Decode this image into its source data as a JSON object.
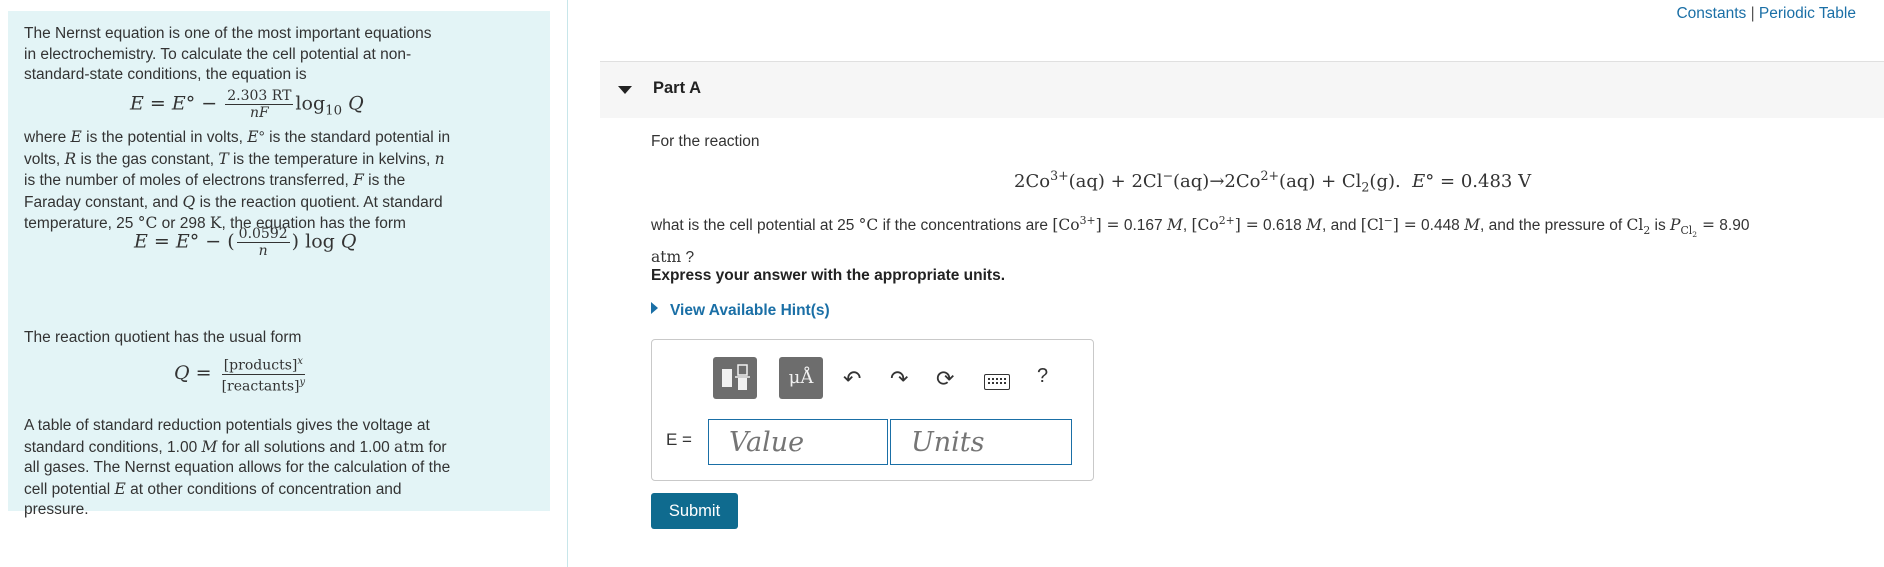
{
  "links": {
    "constants": "Constants",
    "separator": " | ",
    "periodic_table": "Periodic Table"
  },
  "info": {
    "para1": "The Nernst equation is one of the most important equations in electrochemistry. To calculate the cell potential at non-standard-state conditions, the equation is",
    "para2_a": "where ",
    "para2_b": " is the potential in volts, ",
    "para2_c": " is the standard potential in volts, ",
    "para2_d": " is the gas constant, ",
    "para2_e": " is the temperature in kelvins, ",
    "para2_f": " is the number of moles of electrons transferred, ",
    "para2_g": " is the Faraday constant, and ",
    "para2_h": " is the reaction quotient. At standard temperature, 25 ",
    "para2_i": " or 298 ",
    "para2_j": ", the equation has the form",
    "para3": "The reaction quotient has the usual form",
    "para4_a": "A table of standard reduction potentials gives the voltage at standard conditions, 1.00 ",
    "para4_b": " for all solutions and 1.00 ",
    "para4_c": " for all gases. The Nernst equation allows for the calculation of the cell potential ",
    "para4_d": " at other conditions of concentration and pressure.",
    "eq1_frac_num": "2.303 RT",
    "eq1_frac_den": "nF",
    "eq2_frac_num": "0.0592",
    "eq2_frac_den": "n",
    "eq3_num": "[products]",
    "eq3_den": "[reactants]"
  },
  "part": {
    "title": "Part A"
  },
  "question": {
    "intro": "For the reaction",
    "line_a": "what is the cell potential at 25 ",
    "line_b": " if the concentrations are ",
    "co3": "0.167",
    "co2": "0.618",
    "cl": "0.448",
    "pressure": "8.90",
    "and1": ", and ",
    "pressure_text": ", and the pressure of ",
    "is": " is ",
    "units_atm": "atm",
    "q_end": " ?",
    "express": "Express your answer with the appropriate units.",
    "e0_value": "0.483"
  },
  "hint": {
    "label": "View Available Hint(s)"
  },
  "answer": {
    "label": "E =",
    "value_placeholder": "Value",
    "units_placeholder": "Units",
    "submit": "Submit",
    "units_button": "μÅ",
    "help": "?"
  }
}
